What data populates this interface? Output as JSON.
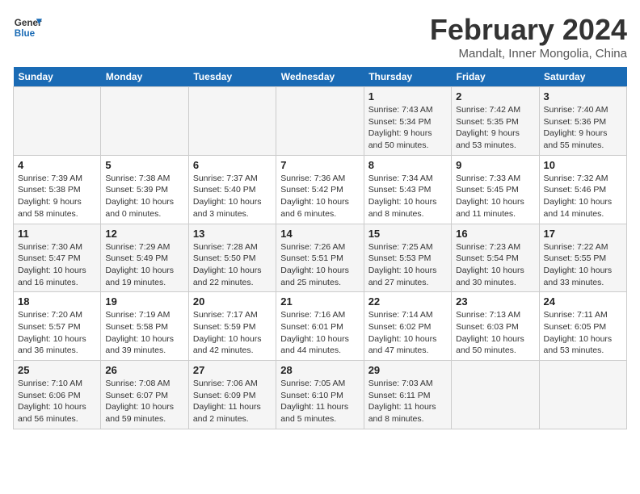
{
  "logo": {
    "line1": "General",
    "line2": "Blue"
  },
  "title": "February 2024",
  "subtitle": "Mandalt, Inner Mongolia, China",
  "weekdays": [
    "Sunday",
    "Monday",
    "Tuesday",
    "Wednesday",
    "Thursday",
    "Friday",
    "Saturday"
  ],
  "weeks": [
    [
      {
        "day": "",
        "info": ""
      },
      {
        "day": "",
        "info": ""
      },
      {
        "day": "",
        "info": ""
      },
      {
        "day": "",
        "info": ""
      },
      {
        "day": "1",
        "info": "Sunrise: 7:43 AM\nSunset: 5:34 PM\nDaylight: 9 hours\nand 50 minutes."
      },
      {
        "day": "2",
        "info": "Sunrise: 7:42 AM\nSunset: 5:35 PM\nDaylight: 9 hours\nand 53 minutes."
      },
      {
        "day": "3",
        "info": "Sunrise: 7:40 AM\nSunset: 5:36 PM\nDaylight: 9 hours\nand 55 minutes."
      }
    ],
    [
      {
        "day": "4",
        "info": "Sunrise: 7:39 AM\nSunset: 5:38 PM\nDaylight: 9 hours\nand 58 minutes."
      },
      {
        "day": "5",
        "info": "Sunrise: 7:38 AM\nSunset: 5:39 PM\nDaylight: 10 hours\nand 0 minutes."
      },
      {
        "day": "6",
        "info": "Sunrise: 7:37 AM\nSunset: 5:40 PM\nDaylight: 10 hours\nand 3 minutes."
      },
      {
        "day": "7",
        "info": "Sunrise: 7:36 AM\nSunset: 5:42 PM\nDaylight: 10 hours\nand 6 minutes."
      },
      {
        "day": "8",
        "info": "Sunrise: 7:34 AM\nSunset: 5:43 PM\nDaylight: 10 hours\nand 8 minutes."
      },
      {
        "day": "9",
        "info": "Sunrise: 7:33 AM\nSunset: 5:45 PM\nDaylight: 10 hours\nand 11 minutes."
      },
      {
        "day": "10",
        "info": "Sunrise: 7:32 AM\nSunset: 5:46 PM\nDaylight: 10 hours\nand 14 minutes."
      }
    ],
    [
      {
        "day": "11",
        "info": "Sunrise: 7:30 AM\nSunset: 5:47 PM\nDaylight: 10 hours\nand 16 minutes."
      },
      {
        "day": "12",
        "info": "Sunrise: 7:29 AM\nSunset: 5:49 PM\nDaylight: 10 hours\nand 19 minutes."
      },
      {
        "day": "13",
        "info": "Sunrise: 7:28 AM\nSunset: 5:50 PM\nDaylight: 10 hours\nand 22 minutes."
      },
      {
        "day": "14",
        "info": "Sunrise: 7:26 AM\nSunset: 5:51 PM\nDaylight: 10 hours\nand 25 minutes."
      },
      {
        "day": "15",
        "info": "Sunrise: 7:25 AM\nSunset: 5:53 PM\nDaylight: 10 hours\nand 27 minutes."
      },
      {
        "day": "16",
        "info": "Sunrise: 7:23 AM\nSunset: 5:54 PM\nDaylight: 10 hours\nand 30 minutes."
      },
      {
        "day": "17",
        "info": "Sunrise: 7:22 AM\nSunset: 5:55 PM\nDaylight: 10 hours\nand 33 minutes."
      }
    ],
    [
      {
        "day": "18",
        "info": "Sunrise: 7:20 AM\nSunset: 5:57 PM\nDaylight: 10 hours\nand 36 minutes."
      },
      {
        "day": "19",
        "info": "Sunrise: 7:19 AM\nSunset: 5:58 PM\nDaylight: 10 hours\nand 39 minutes."
      },
      {
        "day": "20",
        "info": "Sunrise: 7:17 AM\nSunset: 5:59 PM\nDaylight: 10 hours\nand 42 minutes."
      },
      {
        "day": "21",
        "info": "Sunrise: 7:16 AM\nSunset: 6:01 PM\nDaylight: 10 hours\nand 44 minutes."
      },
      {
        "day": "22",
        "info": "Sunrise: 7:14 AM\nSunset: 6:02 PM\nDaylight: 10 hours\nand 47 minutes."
      },
      {
        "day": "23",
        "info": "Sunrise: 7:13 AM\nSunset: 6:03 PM\nDaylight: 10 hours\nand 50 minutes."
      },
      {
        "day": "24",
        "info": "Sunrise: 7:11 AM\nSunset: 6:05 PM\nDaylight: 10 hours\nand 53 minutes."
      }
    ],
    [
      {
        "day": "25",
        "info": "Sunrise: 7:10 AM\nSunset: 6:06 PM\nDaylight: 10 hours\nand 56 minutes."
      },
      {
        "day": "26",
        "info": "Sunrise: 7:08 AM\nSunset: 6:07 PM\nDaylight: 10 hours\nand 59 minutes."
      },
      {
        "day": "27",
        "info": "Sunrise: 7:06 AM\nSunset: 6:09 PM\nDaylight: 11 hours\nand 2 minutes."
      },
      {
        "day": "28",
        "info": "Sunrise: 7:05 AM\nSunset: 6:10 PM\nDaylight: 11 hours\nand 5 minutes."
      },
      {
        "day": "29",
        "info": "Sunrise: 7:03 AM\nSunset: 6:11 PM\nDaylight: 11 hours\nand 8 minutes."
      },
      {
        "day": "",
        "info": ""
      },
      {
        "day": "",
        "info": ""
      }
    ]
  ]
}
